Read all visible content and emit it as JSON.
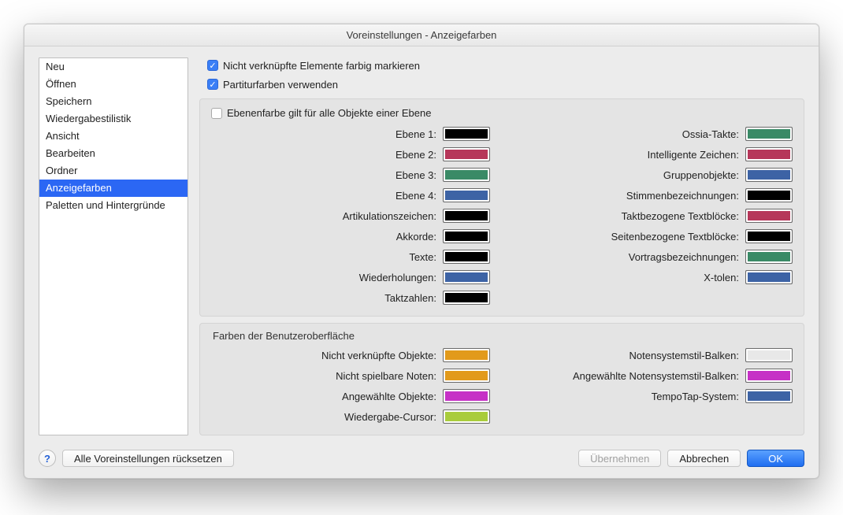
{
  "title": "Voreinstellungen - Anzeigefarben",
  "sidebar": {
    "items": [
      {
        "label": "Neu"
      },
      {
        "label": "Öffnen"
      },
      {
        "label": "Speichern"
      },
      {
        "label": "Wiedergabestilistik"
      },
      {
        "label": "Ansicht"
      },
      {
        "label": "Bearbeiten"
      },
      {
        "label": "Ordner"
      },
      {
        "label": "Anzeigefarben"
      },
      {
        "label": "Paletten und Hintergründe"
      }
    ],
    "selectedIndex": 7
  },
  "checks": {
    "markUnlinked": {
      "label": "Nicht verknüpfte Elemente farbig markieren",
      "checked": true
    },
    "useScoreColors": {
      "label": "Partiturfarben verwenden",
      "checked": true
    }
  },
  "layerGroup": {
    "allObjects": {
      "label": "Ebenenfarbe gilt für alle Objekte einer Ebene",
      "checked": false
    },
    "left": [
      {
        "label": "Ebene 1:",
        "color": "#000000"
      },
      {
        "label": "Ebene 2:",
        "color": "#b6375a"
      },
      {
        "label": "Ebene 3:",
        "color": "#3a8a66"
      },
      {
        "label": "Ebene 4:",
        "color": "#3d63a5"
      },
      {
        "label": "Artikulationszeichen:",
        "color": "#000000"
      },
      {
        "label": "Akkorde:",
        "color": "#000000"
      },
      {
        "label": "Texte:",
        "color": "#000000"
      },
      {
        "label": "Wiederholungen:",
        "color": "#3d63a5"
      },
      {
        "label": "Taktzahlen:",
        "color": "#000000"
      }
    ],
    "right": [
      {
        "label": "Ossia-Takte:",
        "color": "#3a8a66"
      },
      {
        "label": "Intelligente Zeichen:",
        "color": "#b6375a"
      },
      {
        "label": "Gruppenobjekte:",
        "color": "#3d63a5"
      },
      {
        "label": "Stimmenbezeichnungen:",
        "color": "#000000"
      },
      {
        "label": "Taktbezogene Textblöcke:",
        "color": "#b6375a"
      },
      {
        "label": "Seitenbezogene Textblöcke:",
        "color": "#000000"
      },
      {
        "label": "Vortragsbezeichnungen:",
        "color": "#3a8a66"
      },
      {
        "label": "X-tolen:",
        "color": "#3d63a5"
      }
    ]
  },
  "uiGroup": {
    "title": "Farben der Benutzeroberfläche",
    "left": [
      {
        "label": "Nicht verknüpfte Objekte:",
        "color": "#e29a1b"
      },
      {
        "label": "Nicht spielbare Noten:",
        "color": "#e29a1b"
      },
      {
        "label": "Angewählte Objekte:",
        "color": "#c631c6"
      },
      {
        "label": "Wiedergabe-Cursor:",
        "color": "#a9cc3b"
      }
    ],
    "right": [
      {
        "label": "Notensystemstil-Balken:",
        "color": "#e8e8e8"
      },
      {
        "label": "Angewählte Notensystemstil-Balken:",
        "color": "#c631c6"
      },
      {
        "label": "TempoTap-System:",
        "color": "#3d63a5"
      }
    ]
  },
  "footer": {
    "resetAll": "Alle Voreinstellungen rücksetzen",
    "apply": "Übernehmen",
    "cancel": "Abbrechen",
    "ok": "OK"
  }
}
